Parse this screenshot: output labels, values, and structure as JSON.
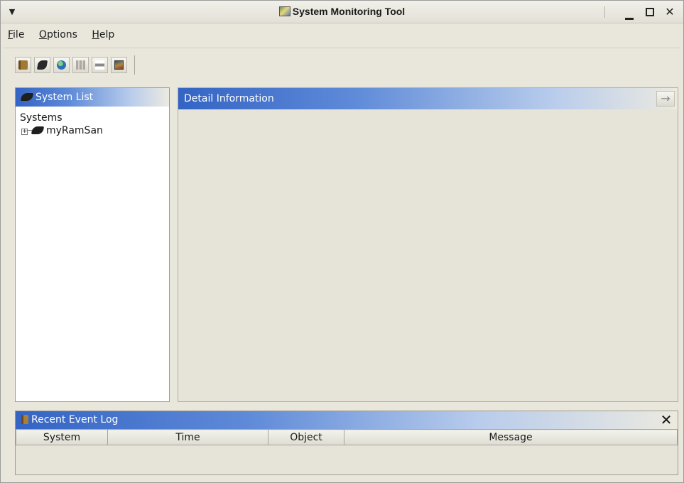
{
  "window": {
    "title": "System Monitoring Tool",
    "menu_button_icon": "chevron-down-icon",
    "controls": [
      "minimize-icon",
      "maximize-icon",
      "close-icon"
    ]
  },
  "menubar": {
    "items": [
      {
        "label": "File",
        "mnemonic": "F",
        "rest": "ile"
      },
      {
        "label": "Options",
        "mnemonic": "O",
        "rest": "ptions"
      },
      {
        "label": "Help",
        "mnemonic": "H",
        "rest": "elp"
      }
    ]
  },
  "toolbar": {
    "buttons": [
      {
        "icon": "event-log-book-icon",
        "enabled": true
      },
      {
        "icon": "system-device-icon",
        "enabled": true
      },
      {
        "icon": "globe-icon",
        "enabled": true
      },
      {
        "icon": "table-icon",
        "enabled": false
      },
      {
        "icon": "property-bar-icon",
        "enabled": false
      },
      {
        "icon": "chart-icon",
        "enabled": true
      }
    ]
  },
  "system_list": {
    "header": "System List",
    "root_label": "Systems",
    "children": [
      {
        "label": "myRamSan",
        "expanded": false
      }
    ]
  },
  "detail": {
    "header": "Detail Information",
    "nav_icon": "arrow-right-icon",
    "nav_glyph": "→"
  },
  "event_log": {
    "header": "Recent Event Log",
    "close_glyph": "✕",
    "columns": [
      "System",
      "Time",
      "Object",
      "Message"
    ],
    "rows": []
  },
  "colors": {
    "header_gradient_start": "#3464c4",
    "background": "#e9e7dc"
  }
}
